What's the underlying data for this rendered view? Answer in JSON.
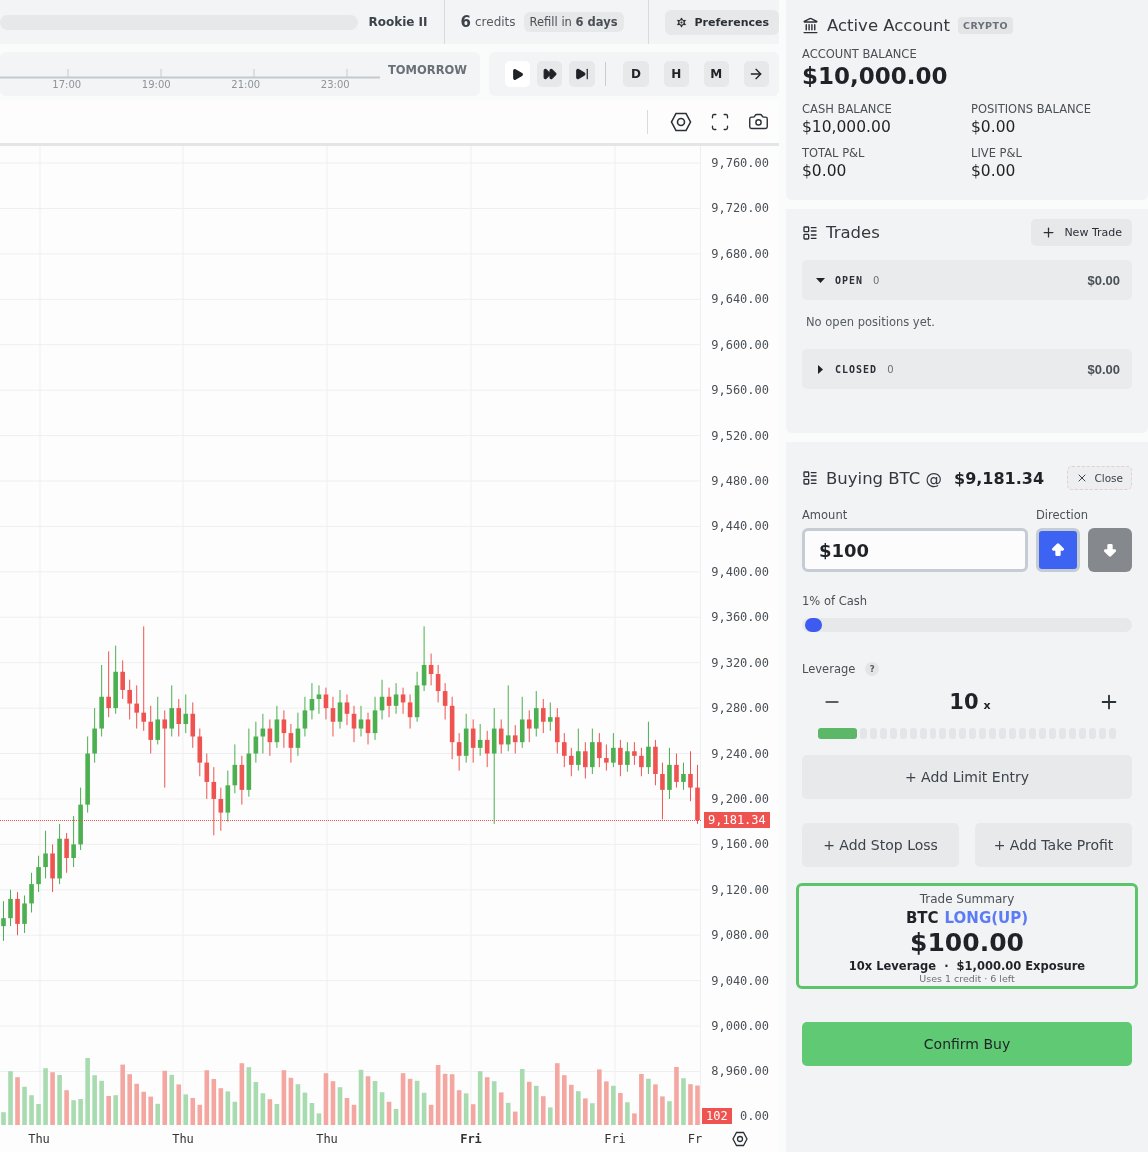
{
  "top_bar": {
    "rank": "Rookie II",
    "credits_count": "6",
    "credits_label": "credits",
    "refill": "Refill in **6 days**",
    "preferences_button": "Preferences"
  },
  "timeline": {
    "times": [
      "17:00",
      "19:00",
      "21:00",
      "23:00"
    ],
    "next_label": "TOMORROW"
  },
  "playback_controls": [
    {
      "kind": "play",
      "selected": true
    },
    {
      "kind": "fast_forward",
      "selected": false
    },
    {
      "kind": "skip_end",
      "selected": false
    }
  ],
  "intervals": [
    "D",
    "H",
    "M"
  ],
  "chart": {
    "covered_tick_label": "0.00",
    "last_price": "9,181.34",
    "volume_tag": "102",
    "time_labels": [
      {
        "label": "Thu",
        "bold": false
      },
      {
        "label": "Thu",
        "bold": false
      },
      {
        "label": "Thu",
        "bold": false
      },
      {
        "label": "Fri",
        "bold": true
      },
      {
        "label": "Fri",
        "bold": false
      },
      {
        "label": "Fr",
        "bold": false
      }
    ],
    "chart_data": {
      "type": "candlestick",
      "ylim": [
        8912,
        9775
      ],
      "yticks": [
        {
          "value": 9760,
          "label": "9,760.00"
        },
        {
          "value": 9720,
          "label": "9,720.00"
        },
        {
          "value": 9680,
          "label": "9,680.00"
        },
        {
          "value": 9640,
          "label": "9,640.00"
        },
        {
          "value": 9600,
          "label": "9,600.00"
        },
        {
          "value": 9560,
          "label": "9,560.00"
        },
        {
          "value": 9520,
          "label": "9,520.00"
        },
        {
          "value": 9480,
          "label": "9,480.00"
        },
        {
          "value": 9440,
          "label": "9,440.00"
        },
        {
          "value": 9400,
          "label": "9,400.00"
        },
        {
          "value": 9360,
          "label": "9,360.00"
        },
        {
          "value": 9320,
          "label": "9,320.00"
        },
        {
          "value": 9280,
          "label": "9,280.00"
        },
        {
          "value": 9240,
          "label": "9,240.00"
        },
        {
          "value": 9200,
          "label": "9,200.00"
        },
        {
          "value": 9160,
          "label": "9,160.00"
        },
        {
          "value": 9120,
          "label": "9,120.00"
        },
        {
          "value": 9080,
          "label": "9,080.00"
        },
        {
          "value": 9040,
          "label": "9,040.00"
        },
        {
          "value": 9000,
          "label": "9,000.00"
        },
        {
          "value": 8960,
          "label": "8,960.00"
        }
      ],
      "grid": true,
      "categories": [
        null,
        null,
        null,
        null,
        null,
        null,
        null,
        null,
        null,
        null,
        null,
        null,
        null,
        null,
        null,
        null,
        null,
        null,
        null,
        null,
        null,
        null,
        null,
        null,
        null,
        null,
        null,
        null,
        null,
        null,
        null,
        null,
        null,
        null,
        null,
        null,
        null,
        null,
        null,
        null,
        null,
        null,
        null,
        null,
        null,
        null,
        null,
        null,
        null,
        null,
        null,
        null,
        null,
        null,
        null,
        null,
        null,
        null,
        null,
        null,
        null,
        null,
        null,
        null,
        null,
        null,
        null,
        null,
        null,
        null,
        null,
        null,
        null,
        null,
        null,
        null,
        null,
        null,
        null,
        null,
        null,
        null,
        null,
        null,
        null,
        null,
        null,
        null,
        null,
        null,
        null,
        null,
        null,
        null,
        null,
        null,
        null,
        null,
        null,
        null
      ],
      "ohlc": [
        [
          9088,
          9110,
          9075,
          9095
        ],
        [
          9095,
          9120,
          9088,
          9112
        ],
        [
          9112,
          9118,
          9080,
          9090
        ],
        [
          9090,
          9115,
          9082,
          9108
        ],
        [
          9108,
          9135,
          9100,
          9125
        ],
        [
          9125,
          9150,
          9118,
          9140
        ],
        [
          9140,
          9172,
          9130,
          9152
        ],
        [
          9152,
          9160,
          9118,
          9130
        ],
        [
          9130,
          9178,
          9125,
          9165
        ],
        [
          9165,
          9170,
          9135,
          9148
        ],
        [
          9148,
          9185,
          9140,
          9160
        ],
        [
          9160,
          9210,
          9155,
          9195
        ],
        [
          9195,
          9255,
          9188,
          9240
        ],
        [
          9240,
          9280,
          9232,
          9262
        ],
        [
          9262,
          9318,
          9255,
          9290
        ],
        [
          9290,
          9330,
          9272,
          9280
        ],
        [
          9280,
          9335,
          9275,
          9312
        ],
        [
          9312,
          9322,
          9288,
          9296
        ],
        [
          9296,
          9305,
          9270,
          9284
        ],
        [
          9284,
          9300,
          9262,
          9276
        ],
        [
          9276,
          9352,
          9260,
          9268
        ],
        [
          9268,
          9282,
          9240,
          9252
        ],
        [
          9252,
          9290,
          9248,
          9270
        ],
        [
          9270,
          9278,
          9210,
          9262
        ],
        [
          9262,
          9300,
          9255,
          9280
        ],
        [
          9280,
          9288,
          9255,
          9266
        ],
        [
          9266,
          9292,
          9258,
          9275
        ],
        [
          9275,
          9285,
          9245,
          9255
        ],
        [
          9255,
          9262,
          9220,
          9232
        ],
        [
          9232,
          9240,
          9200,
          9215
        ],
        [
          9215,
          9228,
          9168,
          9200
        ],
        [
          9200,
          9210,
          9172,
          9188
        ],
        [
          9188,
          9225,
          9180,
          9212
        ],
        [
          9212,
          9248,
          9205,
          9230
        ],
        [
          9230,
          9238,
          9195,
          9208
        ],
        [
          9208,
          9262,
          9202,
          9240
        ],
        [
          9240,
          9268,
          9232,
          9255
        ],
        [
          9255,
          9275,
          9240,
          9262
        ],
        [
          9262,
          9270,
          9238,
          9250
        ],
        [
          9250,
          9282,
          9245,
          9270
        ],
        [
          9270,
          9278,
          9245,
          9258
        ],
        [
          9258,
          9266,
          9232,
          9245
        ],
        [
          9245,
          9276,
          9238,
          9262
        ],
        [
          9262,
          9290,
          9255,
          9278
        ],
        [
          9278,
          9302,
          9270,
          9288
        ],
        [
          9288,
          9300,
          9275,
          9292
        ],
        [
          9292,
          9298,
          9270,
          9280
        ],
        [
          9280,
          9290,
          9255,
          9268
        ],
        [
          9268,
          9296,
          9262,
          9285
        ],
        [
          9285,
          9292,
          9265,
          9275
        ],
        [
          9275,
          9282,
          9250,
          9262
        ],
        [
          9262,
          9282,
          9255,
          9270
        ],
        [
          9270,
          9276,
          9248,
          9258
        ],
        [
          9258,
          9290,
          9252,
          9278
        ],
        [
          9278,
          9305,
          9270,
          9290
        ],
        [
          9290,
          9298,
          9272,
          9282
        ],
        [
          9282,
          9302,
          9275,
          9292
        ],
        [
          9292,
          9298,
          9275,
          9285
        ],
        [
          9285,
          9292,
          9262,
          9272
        ],
        [
          9272,
          9312,
          9268,
          9300
        ],
        [
          9300,
          9352,
          9295,
          9318
        ],
        [
          9318,
          9328,
          9300,
          9310
        ],
        [
          9310,
          9318,
          9285,
          9295
        ],
        [
          9295,
          9302,
          9270,
          9282
        ],
        [
          9282,
          9290,
          9235,
          9250
        ],
        [
          9250,
          9258,
          9225,
          9238
        ],
        [
          9238,
          9275,
          9232,
          9262
        ],
        [
          9262,
          9270,
          9232,
          9245
        ],
        [
          9245,
          9266,
          9238,
          9252
        ],
        [
          9252,
          9260,
          9228,
          9240
        ],
        [
          9240,
          9280,
          9178,
          9262
        ],
        [
          9262,
          9270,
          9240,
          9248
        ],
        [
          9248,
          9300,
          9242,
          9256
        ],
        [
          9256,
          9265,
          9240,
          9250
        ],
        [
          9250,
          9290,
          9245,
          9270
        ],
        [
          9270,
          9278,
          9250,
          9262
        ],
        [
          9262,
          9295,
          9255,
          9280
        ],
        [
          9280,
          9288,
          9258,
          9268
        ],
        [
          9268,
          9285,
          9260,
          9272
        ],
        [
          9272,
          9280,
          9240,
          9250
        ],
        [
          9250,
          9258,
          9228,
          9238
        ],
        [
          9238,
          9245,
          9220,
          9230
        ],
        [
          9230,
          9262,
          9225,
          9242
        ],
        [
          9242,
          9250,
          9218,
          9228
        ],
        [
          9228,
          9262,
          9222,
          9250
        ],
        [
          9250,
          9258,
          9228,
          9236
        ],
        [
          9236,
          9248,
          9225,
          9232
        ],
        [
          9232,
          9258,
          9228,
          9245
        ],
        [
          9245,
          9252,
          9220,
          9230
        ],
        [
          9230,
          9250,
          9224,
          9242
        ],
        [
          9242,
          9250,
          9230,
          9238
        ],
        [
          9238,
          9245,
          9220,
          9228
        ],
        [
          9228,
          9268,
          9222,
          9246
        ],
        [
          9246,
          9252,
          9212,
          9222
        ],
        [
          9222,
          9232,
          9182,
          9208
        ],
        [
          9208,
          9245,
          9200,
          9230
        ],
        [
          9230,
          9240,
          9210,
          9215
        ],
        [
          9215,
          9232,
          9208,
          9222
        ],
        [
          9222,
          9242,
          9198,
          9210
        ],
        [
          9210,
          9230,
          9178,
          9181.34
        ]
      ]
    }
  },
  "account": {
    "title": "Active Account",
    "badge": "CRYPTO",
    "balance_label": "ACCOUNT BALANCE",
    "balance": "$10,000.00",
    "stats": [
      {
        "label": "CASH BALANCE",
        "value": "$10,000.00"
      },
      {
        "label": "POSITIONS BALANCE",
        "value": "$0.00"
      },
      {
        "label": "TOTAL P&L",
        "value": "$0.00"
      },
      {
        "label": "LIVE P&L",
        "value": "$0.00"
      }
    ]
  },
  "trades": {
    "title": "Trades",
    "new_button": "New Trade",
    "groups": [
      {
        "label": "OPEN",
        "count": "0",
        "total": "$0.00",
        "expanded": true,
        "empty_text": "No open positions yet."
      },
      {
        "label": "CLOSED",
        "count": "0",
        "total": "$0.00",
        "expanded": false
      }
    ]
  },
  "order": {
    "title": "Buying BTC @",
    "price": "$9,181.34",
    "close_button": "Close",
    "amount_label": "Amount",
    "amount_value": "$100",
    "direction_label": "Direction",
    "directions": [
      {
        "kind": "up",
        "selected": true
      },
      {
        "kind": "down",
        "selected": false
      }
    ],
    "cash_slider": {
      "label": "1% of Cash",
      "level": 0.01
    },
    "leverage": {
      "label": "Leverage",
      "help": "?",
      "value": "10",
      "unit": "x",
      "level": 0.13
    },
    "limit_button": "+ Add Limit Entry",
    "stop_loss_button": "+ Add Stop Loss",
    "take_profit_button": "+ Add Take Profit",
    "summary": {
      "title": "Trade Summary",
      "symbol": "BTC",
      "direction": "LONG(UP)",
      "amount": "$100.00",
      "details": "10x Leverage  ·  $1,000.00 Exposure",
      "note": "Uses 1 credit · 6 left"
    },
    "confirm_button": "Confirm Buy"
  }
}
